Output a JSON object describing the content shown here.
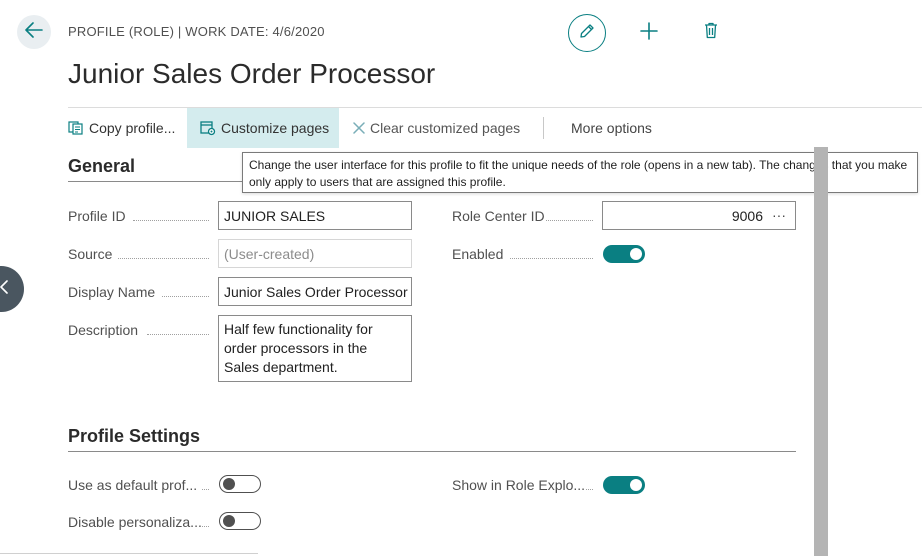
{
  "header": {
    "breadcrumb": "PROFILE (ROLE) | WORK DATE: 4/6/2020",
    "title": "Junior Sales Order Processor"
  },
  "actions": {
    "copy_profile": "Copy profile...",
    "customize_pages": "Customize pages",
    "clear_customized": "Clear customized pages",
    "more_options": "More options"
  },
  "tooltip": {
    "text": "Change the user interface for this profile to fit the unique needs of the role (opens in a new tab). The changes that you make only apply to users that are assigned this profile."
  },
  "general": {
    "title": "General",
    "profile_id_label": "Profile ID",
    "profile_id_value": "JUNIOR SALES",
    "source_label": "Source",
    "source_placeholder": "(User-created)",
    "display_name_label": "Display Name",
    "display_name_value": "Junior Sales Order Processor",
    "description_label": "Description",
    "description_value": "Half few functionality for order processors in the Sales department.",
    "role_center_label": "Role Center ID",
    "role_center_value": "9006",
    "role_center_lookup": "···",
    "enabled_label": "Enabled",
    "enabled": true
  },
  "profile_settings": {
    "title": "Profile Settings",
    "default_profile_label": "Use as default prof...",
    "default_profile": false,
    "disable_personalization_label": "Disable personaliza...",
    "disable_personalization": false,
    "show_in_explorer_label": "Show in Role Explo...",
    "show_in_explorer": true
  },
  "colors": {
    "accent": "#0a7f82",
    "ribbon_active": "#d4ecee"
  }
}
